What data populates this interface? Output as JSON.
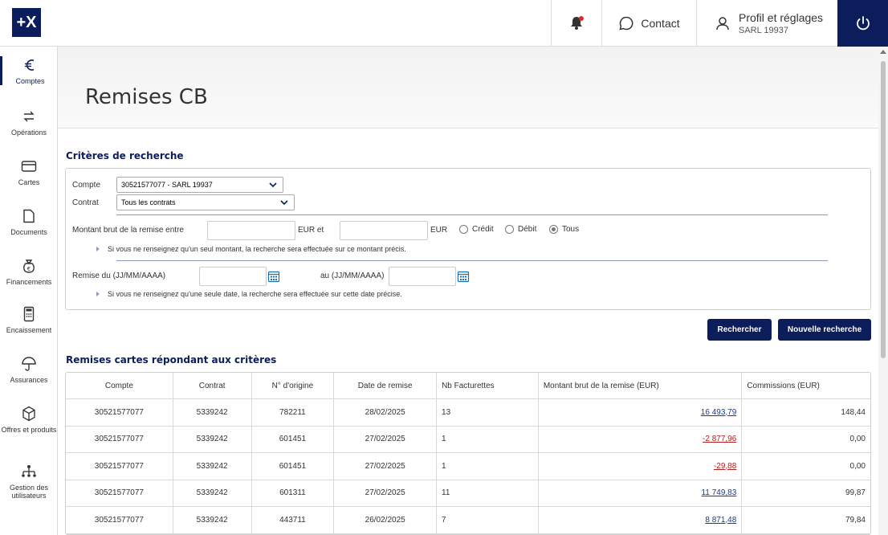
{
  "brand": {
    "logo": "+X",
    "accent": "#0b1e5b"
  },
  "topbar": {
    "contact_label": "Contact",
    "profile_title": "Profil et réglages",
    "profile_sub": "SARL 19937"
  },
  "sidebar": {
    "items": [
      {
        "label": "Comptes",
        "icon": "euro-icon"
      },
      {
        "label": "Opérations",
        "icon": "transfer-arrows-icon"
      },
      {
        "label": "Cartes",
        "icon": "credit-card-icon"
      },
      {
        "label": "Documents",
        "icon": "document-icon"
      },
      {
        "label": "Financements",
        "icon": "money-bag-icon"
      },
      {
        "label": "Encaissement",
        "icon": "calculator-icon"
      },
      {
        "label": "Assurances",
        "icon": "umbrella-icon"
      },
      {
        "label": "Offres et produits",
        "icon": "box-icon"
      },
      {
        "label": "Gestion des utilisateurs",
        "icon": "users-hierarchy-icon"
      }
    ]
  },
  "page": {
    "title": "Remises CB"
  },
  "criteria": {
    "section_title": "Critères de recherche",
    "compte_label": "Compte",
    "compte_value": "30521577077 - SARL 19937",
    "contrat_label": "Contrat",
    "contrat_value": "Tous les contrats",
    "montant_label": "Montant brut de la remise entre",
    "eur_et": "EUR et",
    "eur": "EUR",
    "radio_credit": "Crédit",
    "radio_debit": "Débit",
    "radio_tous": "Tous",
    "hint_montant": "Si vous ne renseignez qu'un seul montant, la recherche sera effectuée sur ce montant précis.",
    "remise_du_label": "Remise du (JJ/MM/AAAA)",
    "au_label": "au (JJ/MM/AAAA)",
    "hint_date": "Si vous ne renseignez qu'une seule date, la recherche sera effectuée sur cette date précise."
  },
  "actions": {
    "search_label": "Rechercher",
    "new_search_label": "Nouvelle recherche"
  },
  "results": {
    "section_title": "Remises cartes répondant aux critères",
    "headers": [
      "Compte",
      "Contrat",
      "N° d'origine",
      "Date de remise",
      "Nb Facturettes",
      "Montant brut de la remise (EUR)",
      "Commissions (EUR)"
    ],
    "rows": [
      [
        "30521577077",
        "5339242",
        "782211",
        "28/02/2025",
        "13",
        "16 493,79",
        "148,44"
      ],
      [
        "30521577077",
        "5339242",
        "601451",
        "27/02/2025",
        "1",
        "-2 877,96",
        "0,00"
      ],
      [
        "30521577077",
        "5339242",
        "601451",
        "27/02/2025",
        "1",
        "-29,88",
        "0,00"
      ],
      [
        "30521577077",
        "5339242",
        "601311",
        "27/02/2025",
        "11",
        "11 749,83",
        "99,87"
      ],
      [
        "30521577077",
        "5339242",
        "443711",
        "26/02/2025",
        "7",
        "8 871,48",
        "79,84"
      ]
    ]
  }
}
